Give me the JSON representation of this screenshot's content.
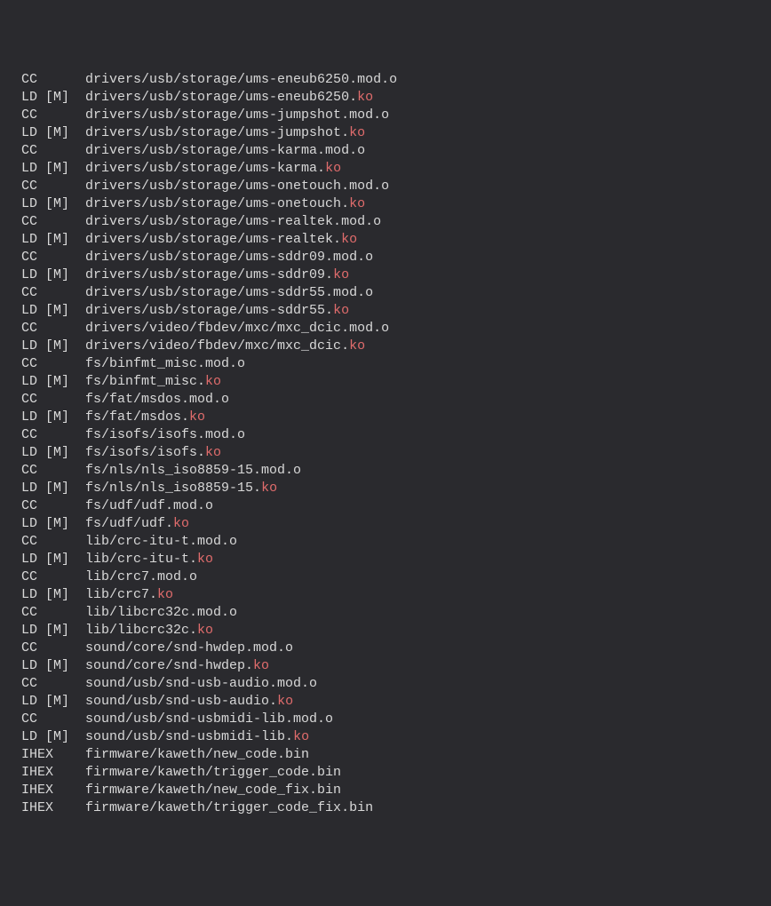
{
  "lines": [
    {
      "stage": "CC",
      "mark": "",
      "path": "drivers/usb/storage/ums-eneub6250.mod.o",
      "hl": ""
    },
    {
      "stage": "LD",
      "mark": "[M]",
      "path": "drivers/usb/storage/ums-eneub6250.",
      "hl": "ko"
    },
    {
      "stage": "CC",
      "mark": "",
      "path": "drivers/usb/storage/ums-jumpshot.mod.o",
      "hl": ""
    },
    {
      "stage": "LD",
      "mark": "[M]",
      "path": "drivers/usb/storage/ums-jumpshot.",
      "hl": "ko"
    },
    {
      "stage": "CC",
      "mark": "",
      "path": "drivers/usb/storage/ums-karma.mod.o",
      "hl": ""
    },
    {
      "stage": "LD",
      "mark": "[M]",
      "path": "drivers/usb/storage/ums-karma.",
      "hl": "ko"
    },
    {
      "stage": "CC",
      "mark": "",
      "path": "drivers/usb/storage/ums-onetouch.mod.o",
      "hl": ""
    },
    {
      "stage": "LD",
      "mark": "[M]",
      "path": "drivers/usb/storage/ums-onetouch.",
      "hl": "ko"
    },
    {
      "stage": "CC",
      "mark": "",
      "path": "drivers/usb/storage/ums-realtek.mod.o",
      "hl": ""
    },
    {
      "stage": "LD",
      "mark": "[M]",
      "path": "drivers/usb/storage/ums-realtek.",
      "hl": "ko"
    },
    {
      "stage": "CC",
      "mark": "",
      "path": "drivers/usb/storage/ums-sddr09.mod.o",
      "hl": ""
    },
    {
      "stage": "LD",
      "mark": "[M]",
      "path": "drivers/usb/storage/ums-sddr09.",
      "hl": "ko"
    },
    {
      "stage": "CC",
      "mark": "",
      "path": "drivers/usb/storage/ums-sddr55.mod.o",
      "hl": ""
    },
    {
      "stage": "LD",
      "mark": "[M]",
      "path": "drivers/usb/storage/ums-sddr55.",
      "hl": "ko"
    },
    {
      "stage": "CC",
      "mark": "",
      "path": "drivers/video/fbdev/mxc/mxc_dcic.mod.o",
      "hl": ""
    },
    {
      "stage": "LD",
      "mark": "[M]",
      "path": "drivers/video/fbdev/mxc/mxc_dcic.",
      "hl": "ko"
    },
    {
      "stage": "CC",
      "mark": "",
      "path": "fs/binfmt_misc.mod.o",
      "hl": ""
    },
    {
      "stage": "LD",
      "mark": "[M]",
      "path": "fs/binfmt_misc.",
      "hl": "ko"
    },
    {
      "stage": "CC",
      "mark": "",
      "path": "fs/fat/msdos.mod.o",
      "hl": ""
    },
    {
      "stage": "LD",
      "mark": "[M]",
      "path": "fs/fat/msdos.",
      "hl": "ko"
    },
    {
      "stage": "CC",
      "mark": "",
      "path": "fs/isofs/isofs.mod.o",
      "hl": ""
    },
    {
      "stage": "LD",
      "mark": "[M]",
      "path": "fs/isofs/isofs.",
      "hl": "ko"
    },
    {
      "stage": "CC",
      "mark": "",
      "path": "fs/nls/nls_iso8859-15.mod.o",
      "hl": ""
    },
    {
      "stage": "LD",
      "mark": "[M]",
      "path": "fs/nls/nls_iso8859-15.",
      "hl": "ko"
    },
    {
      "stage": "CC",
      "mark": "",
      "path": "fs/udf/udf.mod.o",
      "hl": ""
    },
    {
      "stage": "LD",
      "mark": "[M]",
      "path": "fs/udf/udf.",
      "hl": "ko"
    },
    {
      "stage": "CC",
      "mark": "",
      "path": "lib/crc-itu-t.mod.o",
      "hl": ""
    },
    {
      "stage": "LD",
      "mark": "[M]",
      "path": "lib/crc-itu-t.",
      "hl": "ko"
    },
    {
      "stage": "CC",
      "mark": "",
      "path": "lib/crc7.mod.o",
      "hl": ""
    },
    {
      "stage": "LD",
      "mark": "[M]",
      "path": "lib/crc7.",
      "hl": "ko"
    },
    {
      "stage": "CC",
      "mark": "",
      "path": "lib/libcrc32c.mod.o",
      "hl": ""
    },
    {
      "stage": "LD",
      "mark": "[M]",
      "path": "lib/libcrc32c.",
      "hl": "ko"
    },
    {
      "stage": "CC",
      "mark": "",
      "path": "sound/core/snd-hwdep.mod.o",
      "hl": ""
    },
    {
      "stage": "LD",
      "mark": "[M]",
      "path": "sound/core/snd-hwdep.",
      "hl": "ko"
    },
    {
      "stage": "CC",
      "mark": "",
      "path": "sound/usb/snd-usb-audio.mod.o",
      "hl": ""
    },
    {
      "stage": "LD",
      "mark": "[M]",
      "path": "sound/usb/snd-usb-audio.",
      "hl": "ko"
    },
    {
      "stage": "CC",
      "mark": "",
      "path": "sound/usb/snd-usbmidi-lib.mod.o",
      "hl": ""
    },
    {
      "stage": "LD",
      "mark": "[M]",
      "path": "sound/usb/snd-usbmidi-lib.",
      "hl": "ko"
    },
    {
      "stage": "IHEX",
      "mark": "",
      "path": "firmware/kaweth/new_code.bin",
      "hl": ""
    },
    {
      "stage": "IHEX",
      "mark": "",
      "path": "firmware/kaweth/trigger_code.bin",
      "hl": ""
    },
    {
      "stage": "IHEX",
      "mark": "",
      "path": "firmware/kaweth/new_code_fix.bin",
      "hl": ""
    },
    {
      "stage": "IHEX",
      "mark": "",
      "path": "firmware/kaweth/trigger_code_fix.bin",
      "hl": ""
    }
  ]
}
